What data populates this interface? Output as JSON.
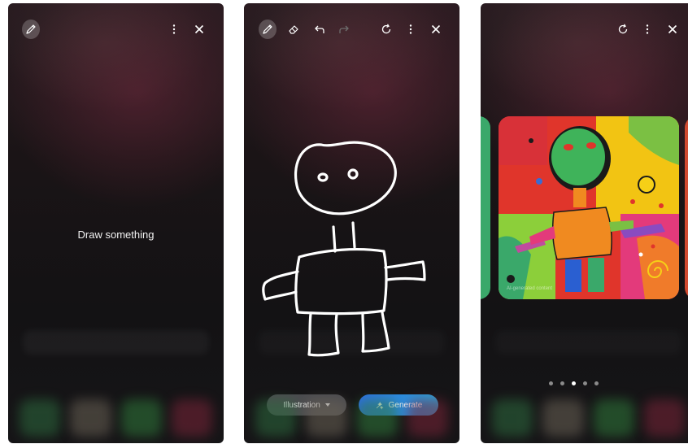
{
  "screens": [
    {
      "toolbar": {
        "icons": [
          "pen-icon",
          "more-vert-icon",
          "close-icon"
        ]
      },
      "placeholder": "Draw something"
    },
    {
      "toolbar": {
        "icons": [
          "pen-icon",
          "eraser-icon",
          "undo-icon",
          "redo-icon",
          "reset-icon",
          "more-vert-icon",
          "close-icon"
        ]
      },
      "style_button": {
        "label": "Illustration"
      },
      "generate_button": {
        "label": "Generate"
      }
    },
    {
      "toolbar": {
        "icons": [
          "reset-icon",
          "more-vert-icon",
          "close-icon"
        ]
      },
      "carousel": {
        "page_count": 5,
        "active_index": 2,
        "watermark": "AI-generated content"
      }
    }
  ],
  "colors": {
    "generate_start": "#2d6ee8",
    "generate_end": "#2aa4d8",
    "style_button_bg": "#4b4b4f"
  }
}
